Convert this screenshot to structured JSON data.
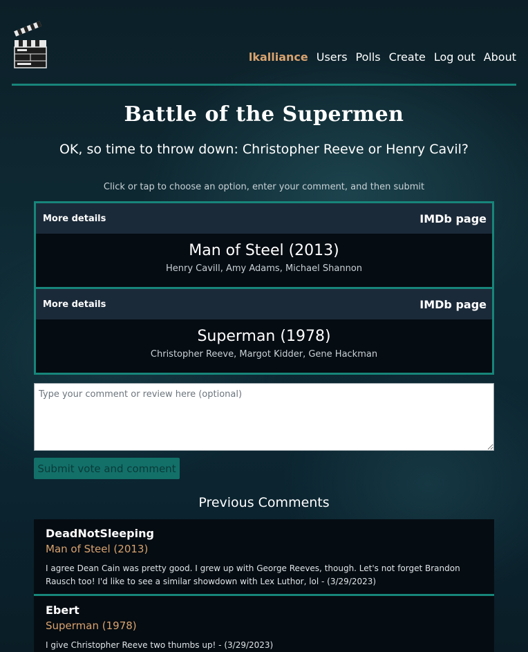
{
  "nav": {
    "items": [
      {
        "label": "lkalliance",
        "active": true
      },
      {
        "label": "Users",
        "active": false
      },
      {
        "label": "Polls",
        "active": false
      },
      {
        "label": "Create",
        "active": false
      },
      {
        "label": "Log out",
        "active": false
      },
      {
        "label": "About",
        "active": false
      }
    ]
  },
  "poll": {
    "title": "Battle of the Supermen",
    "question": "OK, so time to throw down: Christopher Reeve or Henry Cavil?",
    "instructions": "Click or tap to choose an option, enter your comment, and then submit",
    "options": [
      {
        "details_label": "More details",
        "imdb_label": "IMDb page",
        "film": "Man of Steel (2013)",
        "cast": "Henry Cavill, Amy Adams, Michael Shannon"
      },
      {
        "details_label": "More details",
        "imdb_label": "IMDb page",
        "film": "Superman (1978)",
        "cast": "Christopher Reeve, Margot Kidder, Gene Hackman"
      }
    ]
  },
  "comment_form": {
    "placeholder": "Type your comment or review here (optional)",
    "value": "",
    "submit_label": "Submit vote and comment"
  },
  "previous": {
    "heading": "Previous Comments",
    "comments": [
      {
        "user": "DeadNotSleeping",
        "film": "Man of Steel (2013)",
        "text": "I agree Dean Cain was pretty good. I grew up with George Reeves, though. Let's not forget Brandon Rausch too! I'd like to see a similar showdown with Lex Luthor, lol - (3/29/2023)"
      },
      {
        "user": "Ebert",
        "film": "Superman (1978)",
        "text": "I give Christopher Reeve two thumbs up! - (3/29/2023)"
      }
    ]
  },
  "colors": {
    "accent": "#17857a",
    "highlight": "#d9a36f",
    "submit_bg": "#127069"
  }
}
